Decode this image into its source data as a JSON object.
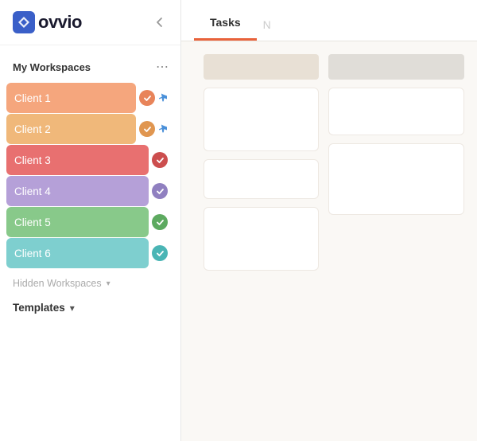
{
  "app": {
    "name": "ovvio",
    "logo_text": "ovvio"
  },
  "sidebar": {
    "my_workspaces_label": "My Workspaces",
    "workspaces": [
      {
        "id": 1,
        "label": "Client 1",
        "color_class": "color-1",
        "check_class": "check-bg-1",
        "pinned": true
      },
      {
        "id": 2,
        "label": "Client 2",
        "color_class": "color-2",
        "check_class": "check-bg-2",
        "pinned": true
      },
      {
        "id": 3,
        "label": "Client 3",
        "color_class": "color-3",
        "check_class": "check-bg-3",
        "pinned": false
      },
      {
        "id": 4,
        "label": "Client 4",
        "color_class": "color-4",
        "check_class": "check-bg-4",
        "pinned": false
      },
      {
        "id": 5,
        "label": "Client 5",
        "color_class": "color-5",
        "check_class": "check-bg-5",
        "pinned": false
      },
      {
        "id": 6,
        "label": "Client 6",
        "color_class": "color-6",
        "check_class": "check-bg-6",
        "pinned": false
      }
    ],
    "hidden_workspaces_label": "Hidden Workspaces",
    "templates_label": "Templates"
  },
  "main": {
    "tabs": [
      {
        "id": "tasks",
        "label": "Tasks",
        "active": true
      },
      {
        "id": "notes",
        "label": "N",
        "active": false
      }
    ]
  }
}
